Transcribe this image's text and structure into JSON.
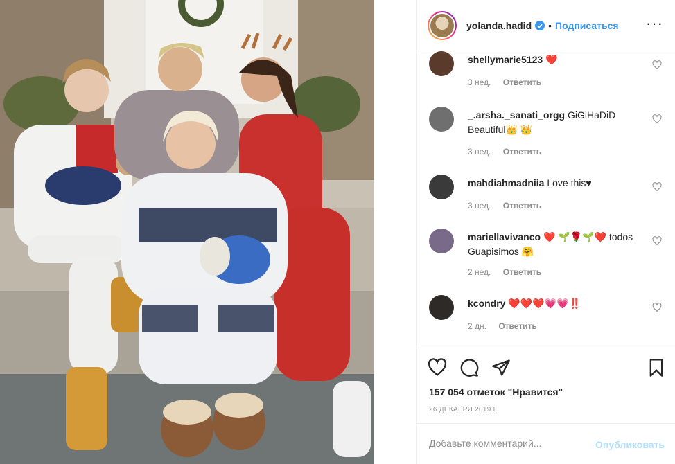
{
  "post": {
    "photo_alt": "",
    "username": "yolanda.hadid",
    "follow_label": "Подписаться",
    "separator": "•",
    "more_label": "···"
  },
  "comments": [
    {
      "user": "shellymarie5123",
      "text": "❤️",
      "time": "3 нед.",
      "reply": "Ответить",
      "avatar_color": "#5a3a2a"
    },
    {
      "user": "_.arsha._sanati_orgg",
      "text": "GiGiHaDiD Beautiful👑 👑",
      "time": "3 нед.",
      "reply": "Ответить",
      "avatar_color": "#6f6f6f"
    },
    {
      "user": "mahdiahmadniia",
      "text": "Love this♥",
      "time": "3 нед.",
      "reply": "Ответить",
      "avatar_color": "#3a3a3a"
    },
    {
      "user": "mariellavivanco",
      "text": "❤️ 🌱🌹🌱❤️ todos Guapisimos 🤗",
      "time": "2 нед.",
      "reply": "Ответить",
      "avatar_color": "#7a6a8a"
    },
    {
      "user": "kcondry",
      "text": "❤️❤️❤️💗💗‼️",
      "time": "2 дн.",
      "reply": "Ответить",
      "avatar_color": "#2e2a28"
    }
  ],
  "stats": {
    "likes": "157 054 отметок \"Нравится\"",
    "date": "26 ДЕКАБРЯ 2019 Г."
  },
  "composer": {
    "placeholder": "Добавьте комментарий...",
    "publish_label": "Опубликовать"
  },
  "colors": {
    "link_blue": "#3897f0",
    "publish_disabled": "#b2dffc",
    "meta_gray": "#8e8e8e",
    "border": "#efefef"
  },
  "icons": [
    "verified-badge-icon",
    "more-options-icon",
    "heart-icon",
    "comment-icon",
    "share-icon",
    "bookmark-icon"
  ]
}
